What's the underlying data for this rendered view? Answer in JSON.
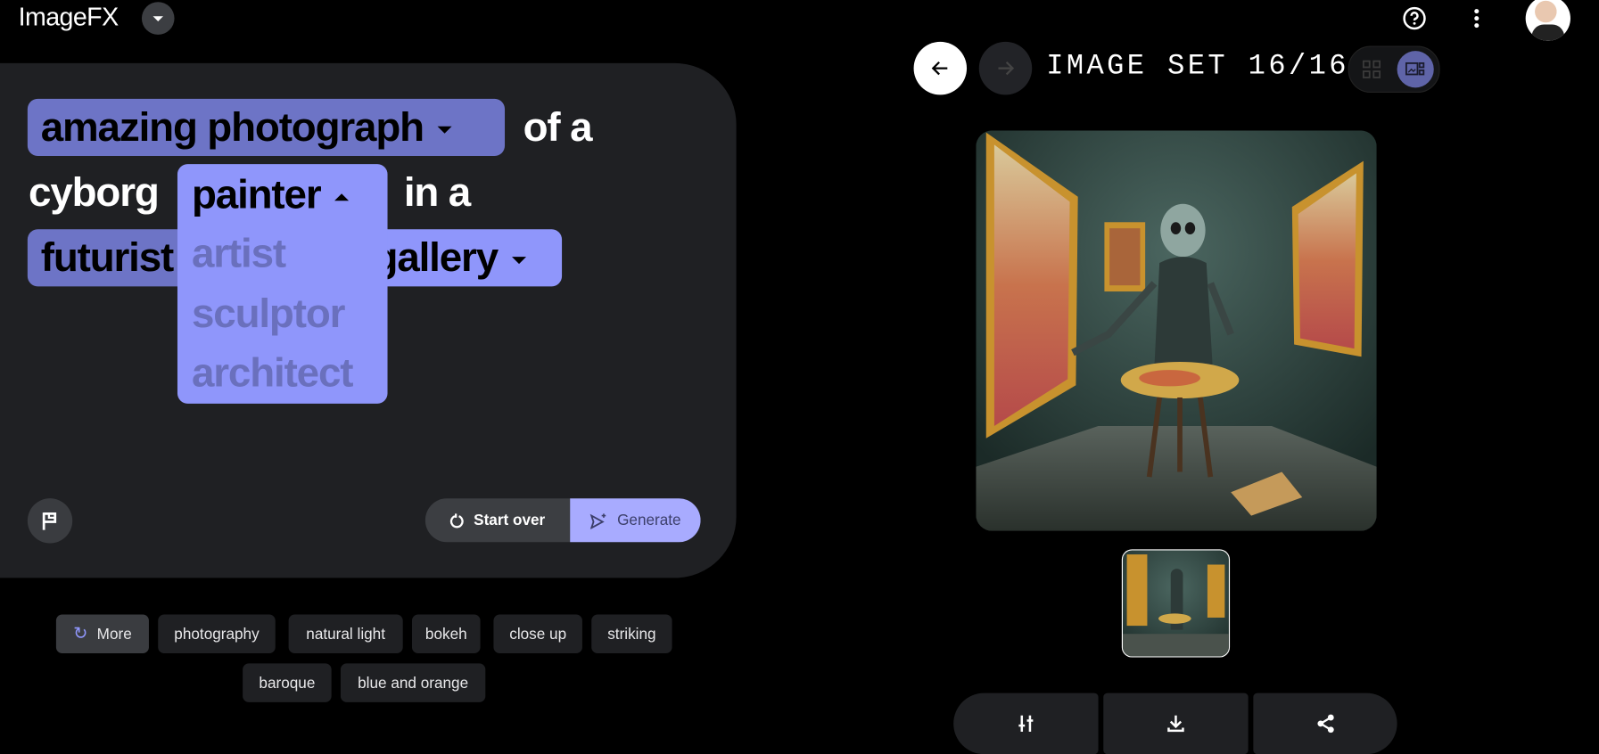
{
  "app": {
    "title": "ImageFX"
  },
  "prompt": {
    "chip1": "amazing photograph",
    "text1": "of a",
    "text2": "cyborg",
    "chip2": "painter",
    "text3": "in a",
    "chip3_left": "futurist",
    "chip3_right": "gallery",
    "dropdown_options": [
      "artist",
      "sculptor",
      "architect"
    ]
  },
  "actions": {
    "start_over": "Start over",
    "generate": "Generate"
  },
  "suggestions": {
    "more": "More",
    "tags": [
      "photography",
      "natural light",
      "bokeh",
      "close up",
      "striking",
      "baroque",
      "blue and orange"
    ]
  },
  "viewer": {
    "image_set_label": "IMAGE SET 16/16"
  },
  "colors": {
    "chip_dark": "#6d74c6",
    "chip_light": "#8f96fb",
    "generate_bg": "#a8abff",
    "card_bg": "#1f2023"
  },
  "icons": {
    "help": "help-circle-icon",
    "more": "more-vert-icon",
    "back": "arrow-left-icon",
    "forward": "arrow-right-icon",
    "grid": "grid-view-icon",
    "single": "single-view-icon",
    "flag": "flag-icon",
    "refresh": "refresh-icon",
    "edit": "tune-icon",
    "download": "download-icon",
    "share": "share-icon"
  }
}
